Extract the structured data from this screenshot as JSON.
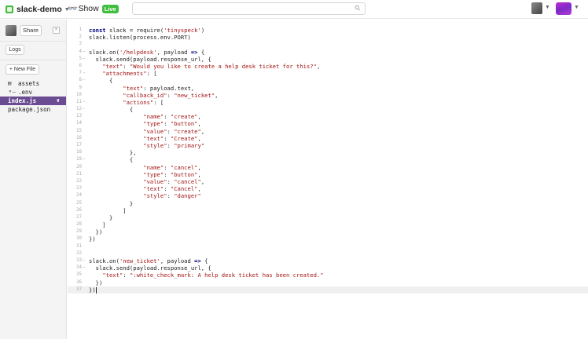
{
  "header": {
    "project_name": "slack-demo",
    "show_label": "Show",
    "live_badge": "Live",
    "search_value": ""
  },
  "sidebar": {
    "share_label": "Share",
    "logs_label": "Logs",
    "new_file_label": "+ New File",
    "files": [
      {
        "name": "assets",
        "icon": "folder-icon"
      },
      {
        "name": ".env",
        "icon": "key-icon"
      },
      {
        "name": "index.js",
        "icon": "",
        "active": true
      },
      {
        "name": "package.json",
        "icon": ""
      }
    ]
  },
  "editor": {
    "file": "index.js",
    "lines": [
      "const slack = require('tinyspeck')",
      "slack.listen(process.env.PORT)",
      "",
      "slack.on('/helpdesk', payload => {",
      "  slack.send(payload.response_url, {",
      "    \"text\": \"Would you like to create a help desk ticket for this?\",",
      "    \"attachments\": [",
      "      {",
      "          \"text\": payload.text,",
      "          \"callback_id\": \"new_ticket\",",
      "          \"actions\": [",
      "            {",
      "                \"name\": \"create\",",
      "                \"type\": \"button\",",
      "                \"value\": \"create\",",
      "                \"text\": \"Create\",",
      "                \"style\": \"primary\"",
      "            },",
      "            {",
      "                \"name\": \"cancel\",",
      "                \"type\": \"button\",",
      "                \"value\": \"cancel\",",
      "                \"text\": \"Cancel\",",
      "                \"style\": \"danger\"",
      "            }",
      "          ]",
      "      }",
      "    ]",
      "  })",
      "})",
      "",
      "",
      "slack.on('new_ticket', payload => {",
      "  slack.send(payload.response_url, {",
      "    \"text\": \":white_check_mark: A help desk ticket has been created.\"",
      "  })",
      "})"
    ],
    "fold_lines": [
      4,
      5,
      7,
      8,
      11,
      12,
      19,
      33,
      34
    ]
  }
}
